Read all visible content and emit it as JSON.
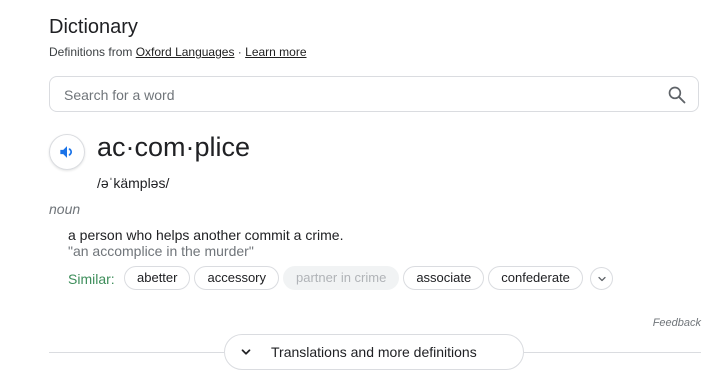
{
  "header": {
    "title": "Dictionary",
    "source_prefix": "Definitions from",
    "source_link": "Oxford Languages",
    "separator": " · ",
    "learn_more": "Learn more"
  },
  "search": {
    "placeholder": "Search for a word",
    "value": "",
    "icon": "search-icon"
  },
  "entry": {
    "speaker_icon": "volume-icon",
    "word": "ac·com·plice",
    "phonetic": "/əˈkämpləs/",
    "part_of_speech": "noun",
    "definition": "a person who helps another commit a crime.",
    "example": "\"an accomplice in the murder\"",
    "similar_label": "Similar:",
    "similar": [
      {
        "label": "abetter",
        "disabled": false
      },
      {
        "label": "accessory",
        "disabled": false
      },
      {
        "label": "partner in crime",
        "disabled": true
      },
      {
        "label": "associate",
        "disabled": false
      },
      {
        "label": "confederate",
        "disabled": false
      }
    ]
  },
  "footer": {
    "feedback": "Feedback",
    "translations_label": "Translations and more definitions"
  },
  "colors": {
    "text": "#202124",
    "muted": "#70757a",
    "similar_green": "#3e8e5b",
    "accent_blue": "#1a73e8",
    "border": "#dadce0"
  }
}
